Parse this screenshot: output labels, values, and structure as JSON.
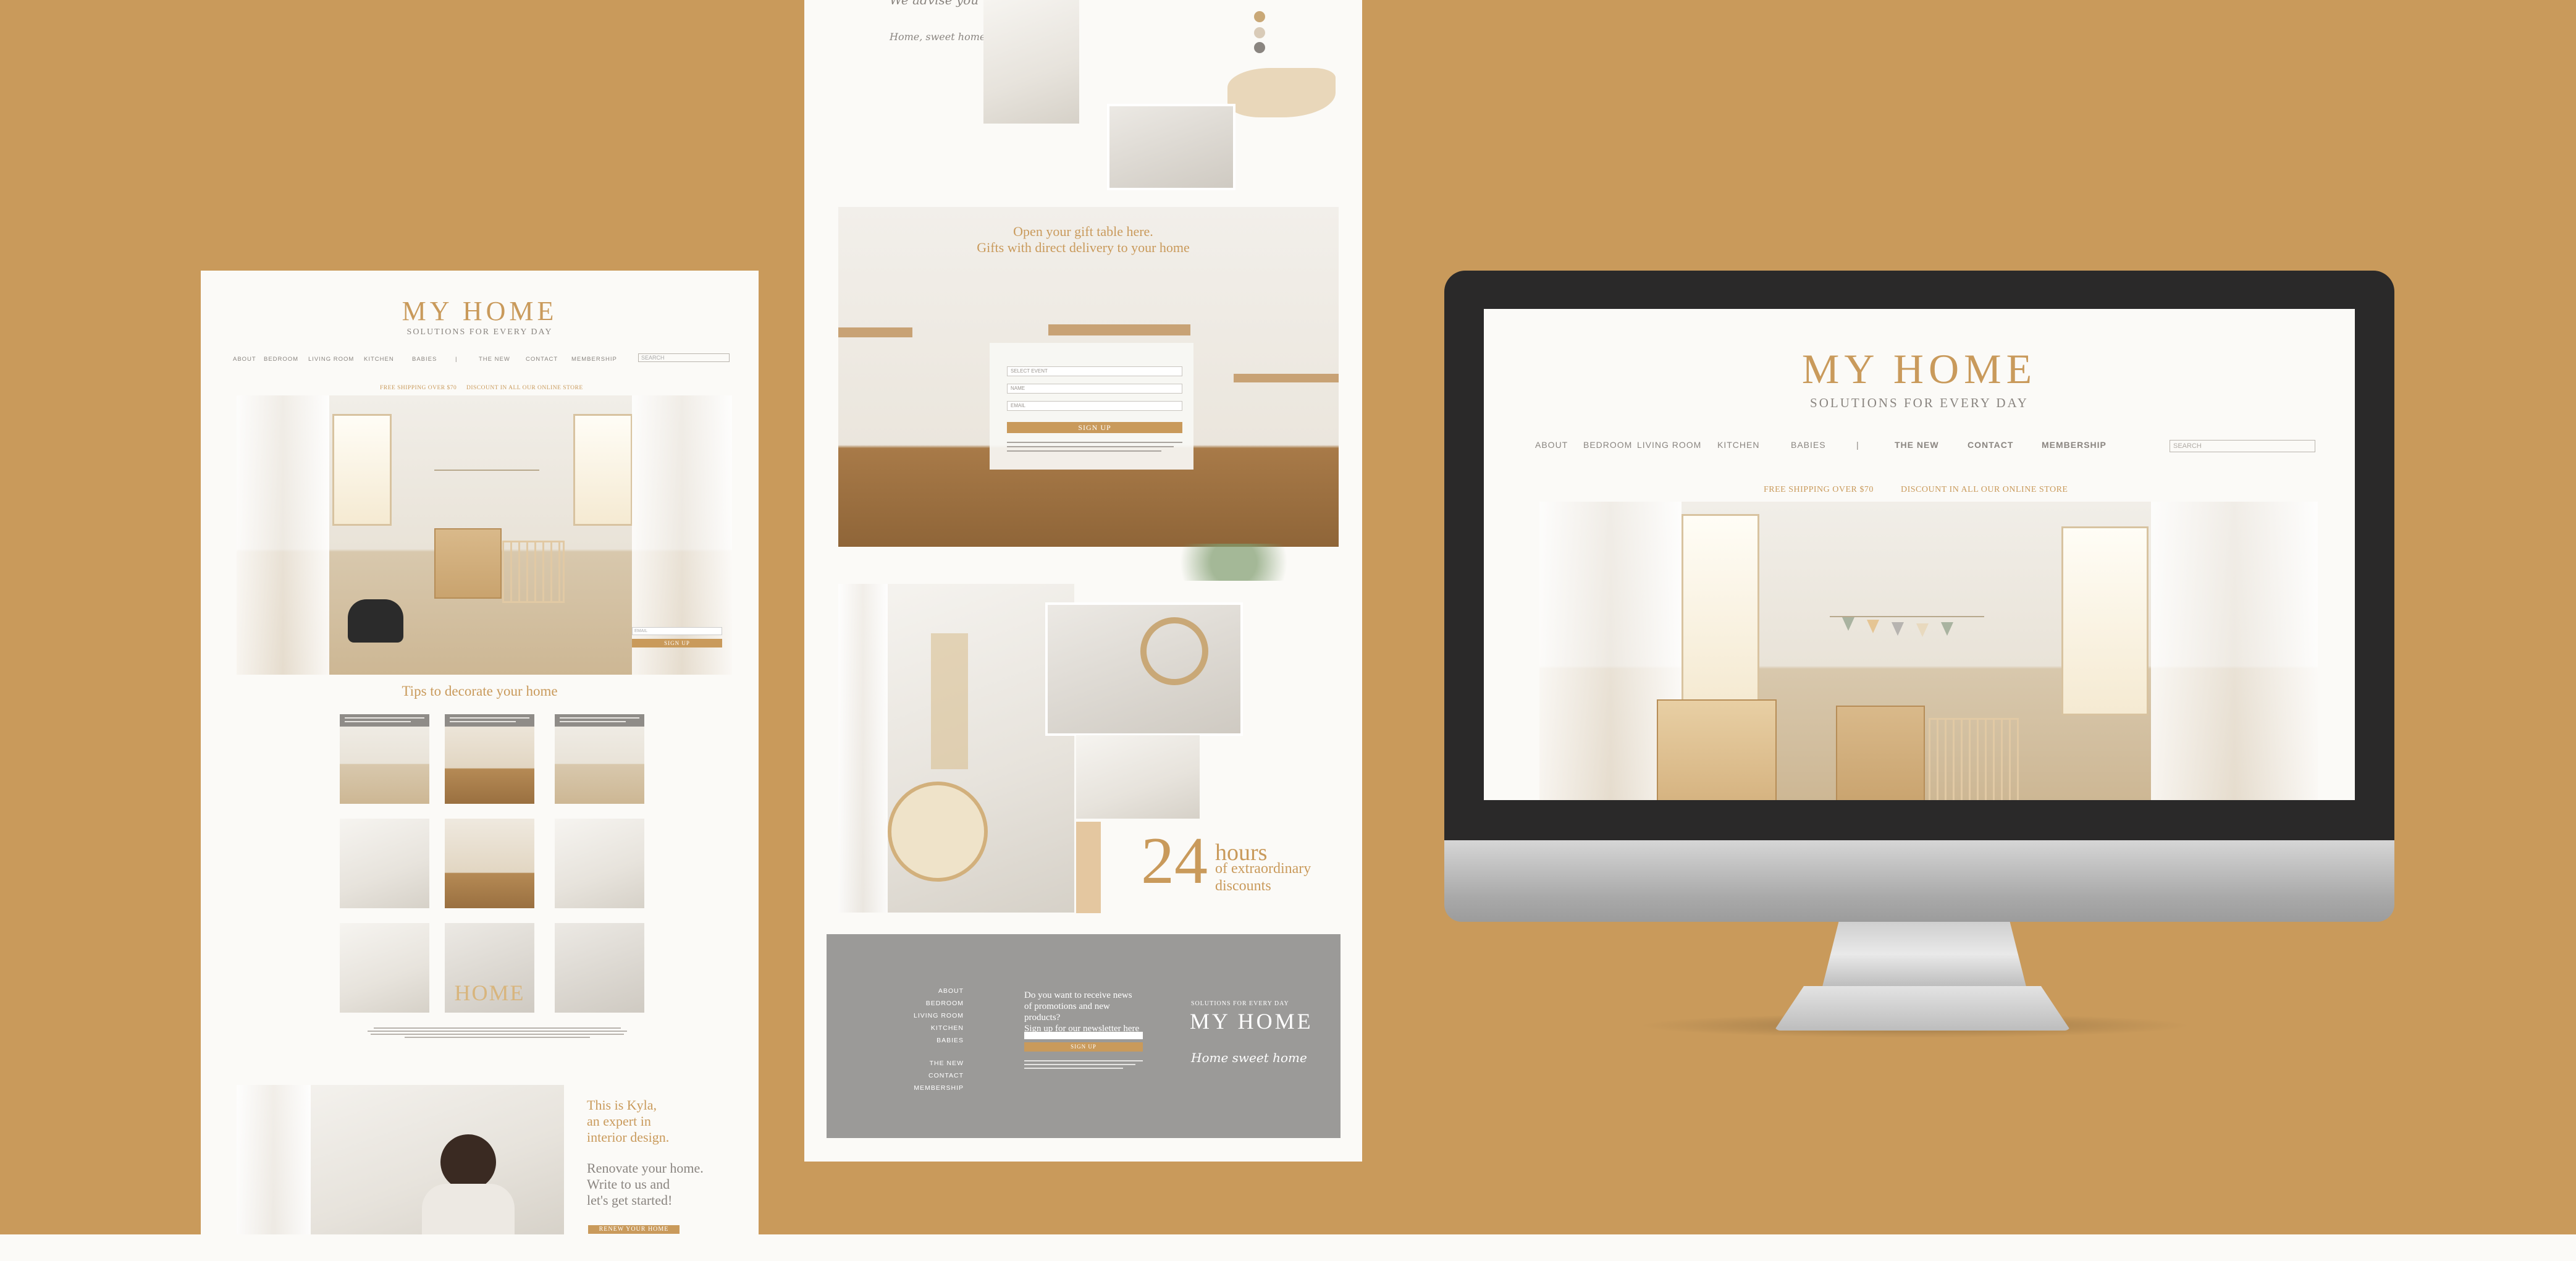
{
  "colors": {
    "background": "#c99a5b",
    "accent": "#c99a5b",
    "page": "#fbfaf7",
    "footer": "#9b9a98",
    "text_muted": "#8a8580"
  },
  "left_page": {
    "brand": "MY HOME",
    "tagline": "SOLUTIONS FOR EVERY DAY",
    "nav": [
      "ABOUT",
      "BEDROOM",
      "LIVING ROOM",
      "KITCHEN",
      "BABIES",
      "|",
      "THE NEW",
      "CONTACT",
      "MEMBERSHIP"
    ],
    "search_placeholder": "SEARCH",
    "promo": [
      "FREE SHIPPING OVER $70",
      "DISCOUNT IN ALL OUR ONLINE STORE"
    ],
    "hero_form": {
      "field_placeholder": "EMAIL",
      "button": "SIGN UP"
    },
    "tips_title": "Tips to decorate your home",
    "tile_word": "HOME",
    "kyla_intro": [
      "This is Kyla,",
      "an expert in",
      "interior design."
    ],
    "kyla_call": [
      "Renovate your home.",
      "Write to us and",
      "let's get started!"
    ],
    "kyla_button": "RENEW YOUR HOME"
  },
  "center_page": {
    "top_line": "We advise you",
    "top_script": "Home, sweet home",
    "gift_lines": [
      "Open your gift table here.",
      "Gifts with direct delivery to your home"
    ],
    "form": {
      "fields": [
        "SELECT EVENT",
        "NAME",
        "EMAIL"
      ],
      "button": "SIGN UP"
    },
    "hours": {
      "number": "24",
      "word": "hours",
      "sub": [
        "of extraordinary",
        "discounts"
      ]
    },
    "footer": {
      "links_a": [
        "ABOUT",
        "BEDROOM",
        "LIVING ROOM",
        "KITCHEN",
        "BABIES"
      ],
      "links_b": [
        "THE NEW",
        "CONTACT",
        "MEMBERSHIP"
      ],
      "newsletter": [
        "Do you want to receive news",
        "of promotions and new products?",
        "Sign up for our newsletter here"
      ],
      "button": "SIGN UP",
      "tagline": "SOLUTIONS FOR EVERY DAY",
      "brand": "MY HOME",
      "script": "Home sweet home"
    }
  },
  "monitor": {
    "brand": "MY HOME",
    "tagline": "SOLUTIONS FOR EVERY DAY",
    "nav": [
      "ABOUT",
      "BEDROOM",
      "LIVING ROOM",
      "KITCHEN",
      "BABIES",
      "|",
      "THE NEW",
      "CONTACT",
      "MEMBERSHIP"
    ],
    "search_placeholder": "SEARCH",
    "promo": [
      "FREE SHIPPING OVER $70",
      "DISCOUNT IN ALL OUR ONLINE STORE"
    ]
  }
}
